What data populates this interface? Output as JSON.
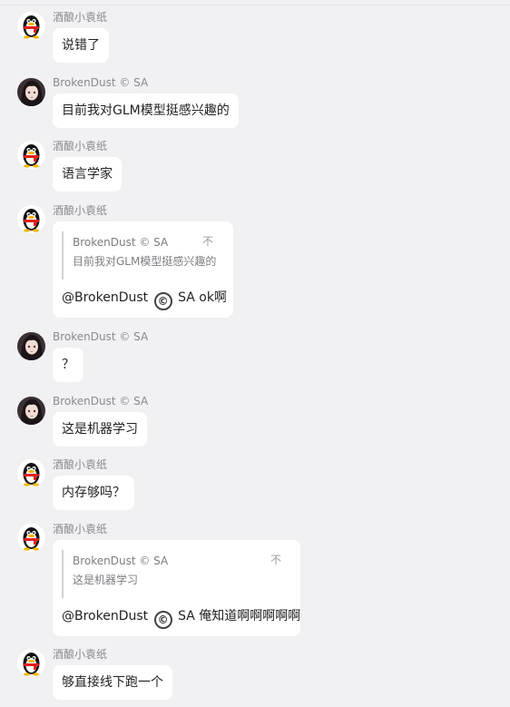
{
  "users": {
    "jiuniang": "酒酿小袁纸",
    "brokendust": "BrokenDust © SA"
  },
  "messages": [
    {
      "sender": "酒酿小袁纸",
      "text": "说错了"
    },
    {
      "sender": "BrokenDust © SA",
      "text": "目前我对GLM模型挺感兴趣的"
    },
    {
      "sender": "酒酿小袁纸",
      "text": "语言学家"
    },
    {
      "sender": "酒酿小袁纸",
      "quote_name": "BrokenDust © SA",
      "quote_text": "目前我对GLM模型挺感兴趣的",
      "mention_name": "@BrokenDust",
      "mention_symbol": "©",
      "mention_suffix": "SA",
      "reply_text": "ok啊",
      "quote_icon": "不"
    },
    {
      "sender": "BrokenDust © SA",
      "text": "？"
    },
    {
      "sender": "BrokenDust © SA",
      "text": "这是机器学习"
    },
    {
      "sender": "酒酿小袁纸",
      "text": "内存够吗？"
    },
    {
      "sender": "酒酿小袁纸",
      "quote_name": "BrokenDust © SA",
      "quote_text": "这是机器学习",
      "mention_name": "@BrokenDust",
      "mention_symbol": "©",
      "mention_suffix": "SA",
      "reply_text": "俺知道啊啊啊啊啊",
      "quote_icon": "不"
    },
    {
      "sender": "酒酿小袁纸",
      "text": "够直接线下跑一个"
    }
  ],
  "colors": {
    "background": "#f1f1f3",
    "bubble": "#ffffff",
    "name": "#8a8a8f",
    "text": "#222222"
  },
  "icons": {
    "penguin_avatar": "qq-penguin-avatar",
    "anime_avatar": "anime-girl-avatar",
    "quote_icon": "pin-icon"
  }
}
